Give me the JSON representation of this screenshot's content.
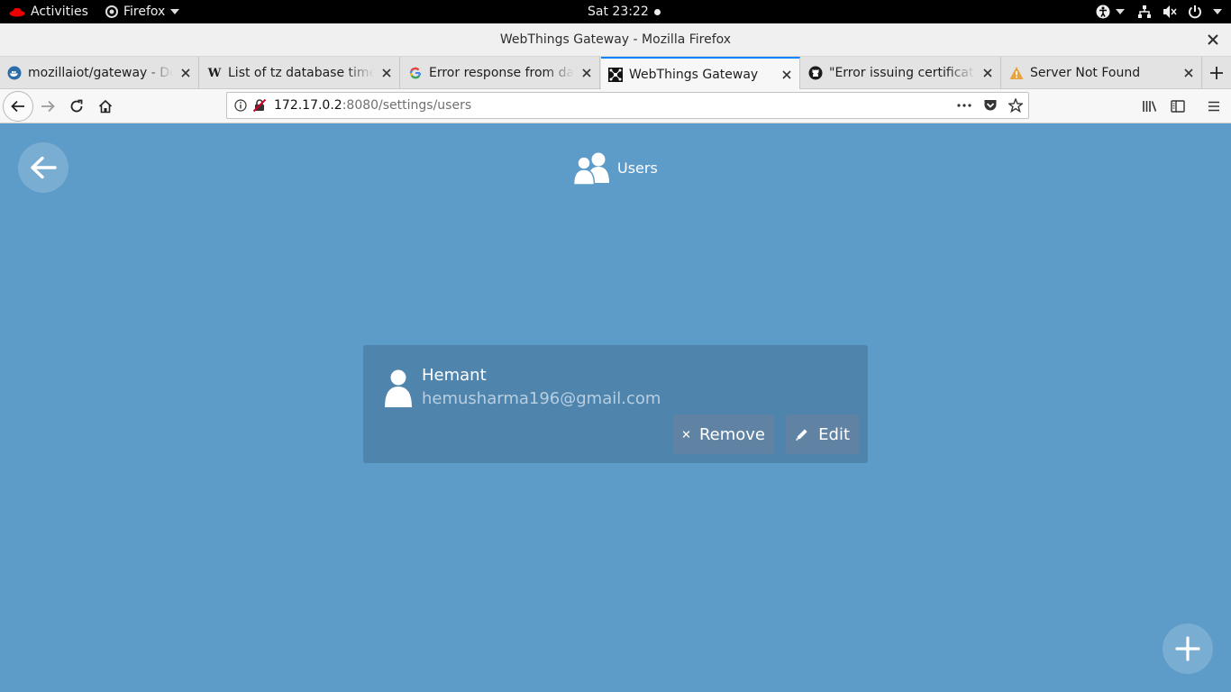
{
  "topbar": {
    "activities": "Activities",
    "app_menu": "Firefox",
    "clock": "Sat 23:22"
  },
  "window": {
    "title": "WebThings Gateway - Mozilla Firefox"
  },
  "tabs": [
    {
      "label": "mozillaiot/gateway - Dock",
      "icon": "docker-icon"
    },
    {
      "label": "List of tz database time zo",
      "icon": "wikipedia-icon"
    },
    {
      "label": "Error response from daem",
      "icon": "google-icon"
    },
    {
      "label": "WebThings Gateway",
      "icon": "webthings-icon",
      "active": true
    },
    {
      "label": "\"Error issuing certificate\"",
      "icon": "github-icon"
    },
    {
      "label": "Server Not Found",
      "icon": "warning-icon"
    }
  ],
  "url": {
    "host": "172.17.0.2",
    "path": ":8080/settings/users"
  },
  "page": {
    "title": "Users",
    "users": [
      {
        "name": "Hemant",
        "email": "hemusharma196@gmail.com",
        "remove_label": "Remove",
        "edit_label": "Edit"
      }
    ]
  },
  "colors": {
    "page_bg": "#5d9bc9",
    "card_bg": "#4f84ad",
    "tab_accent": "#0a84ff"
  }
}
